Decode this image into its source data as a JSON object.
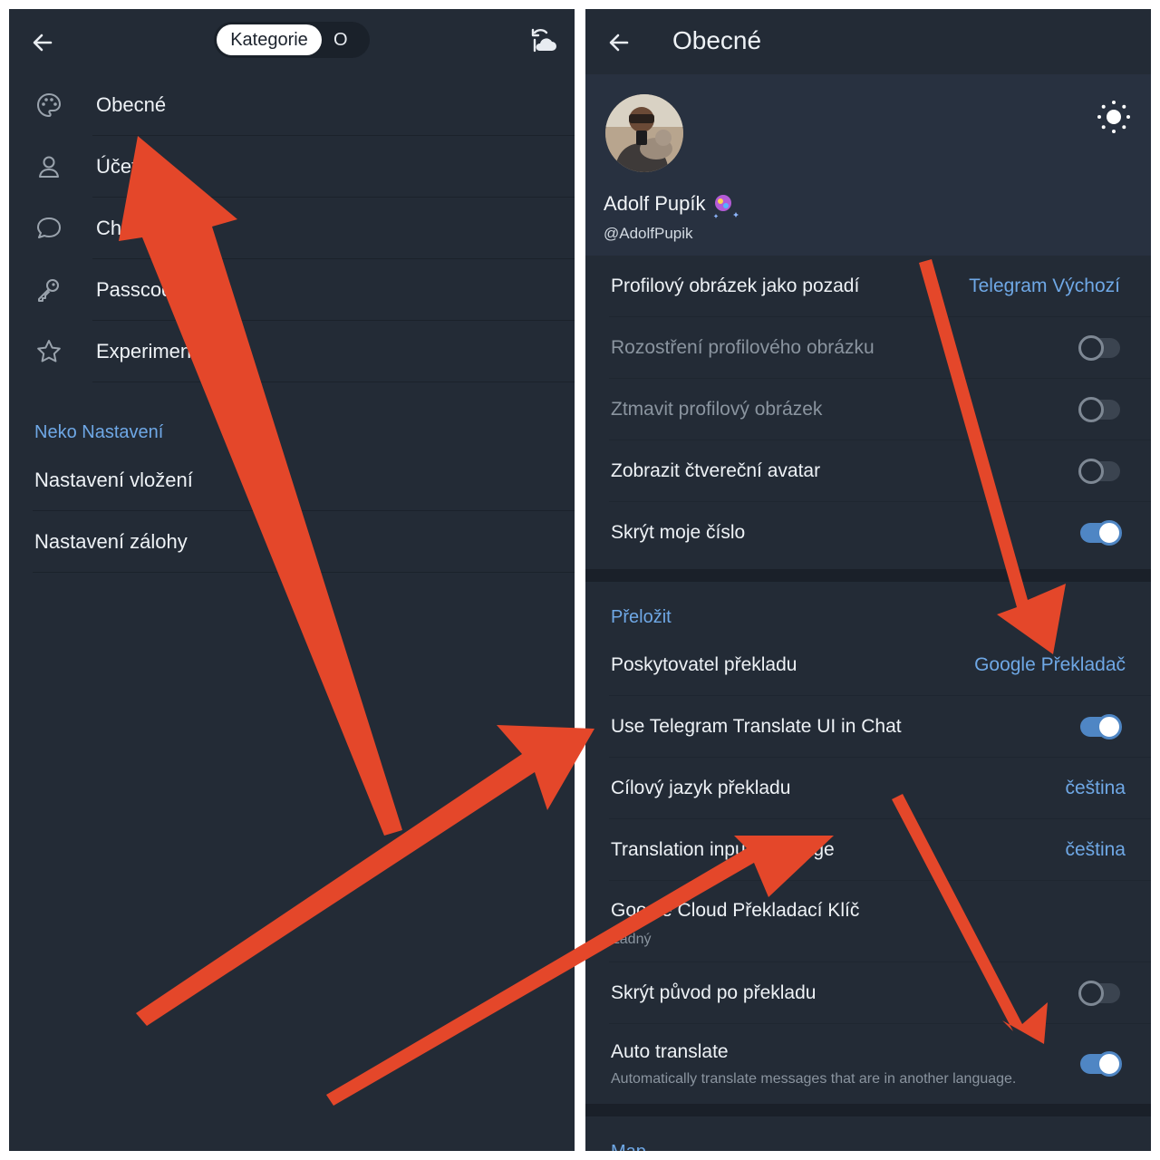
{
  "left": {
    "tabs": [
      {
        "label": "Kategorie"
      },
      {
        "label": "O"
      }
    ],
    "menu": [
      {
        "label": "Obecné",
        "icon": "palette-icon"
      },
      {
        "label": "Účet",
        "icon": "person-icon"
      },
      {
        "label": "Chat",
        "icon": "chat-bubble-icon"
      },
      {
        "label": "Passcode",
        "icon": "key-icon"
      },
      {
        "label": "Experimenty",
        "icon": "star-icon"
      }
    ],
    "section_title": "Neko Nastavení",
    "items": [
      {
        "label": "Nastavení vložení"
      },
      {
        "label": "Nastavení zálohy"
      }
    ]
  },
  "right": {
    "title": "Obecné",
    "profile": {
      "name": "Adolf Pupík",
      "username": "@AdolfPupik"
    },
    "settings": [
      {
        "label": "Profilový obrázek jako pozadí",
        "value": "Telegram Výchozí"
      },
      {
        "label": "Rozostření profilového obrázku",
        "toggle": "off",
        "disabled": true
      },
      {
        "label": "Ztmavit profilový obrázek",
        "toggle": "off",
        "disabled": true
      },
      {
        "label": "Zobrazit čtvereční avatar",
        "toggle": "off"
      },
      {
        "label": "Skrýt moje číslo",
        "toggle": "on"
      }
    ],
    "translate_section": "Přeložit",
    "translate": [
      {
        "label": "Poskytovatel překladu",
        "value": "Google Překladač"
      },
      {
        "label": "Use Telegram Translate UI in Chat",
        "toggle": "on"
      },
      {
        "label": "Cílový jazyk překladu",
        "value": "čeština"
      },
      {
        "label": "Translation input language",
        "value": "čeština"
      },
      {
        "label": "Google Cloud Překladací Klíč",
        "sub": "Žádný"
      },
      {
        "label": "Skrýt původ po překladu",
        "toggle": "off"
      },
      {
        "label": "Auto translate",
        "sub": "Automatically translate messages that are in another language.",
        "toggle": "on"
      }
    ],
    "next_section": "Map"
  },
  "colors": {
    "background": "#232b36",
    "accent": "#6fa8e6",
    "toggle_on": "#4f86c4",
    "arrow": "#e4472a"
  }
}
